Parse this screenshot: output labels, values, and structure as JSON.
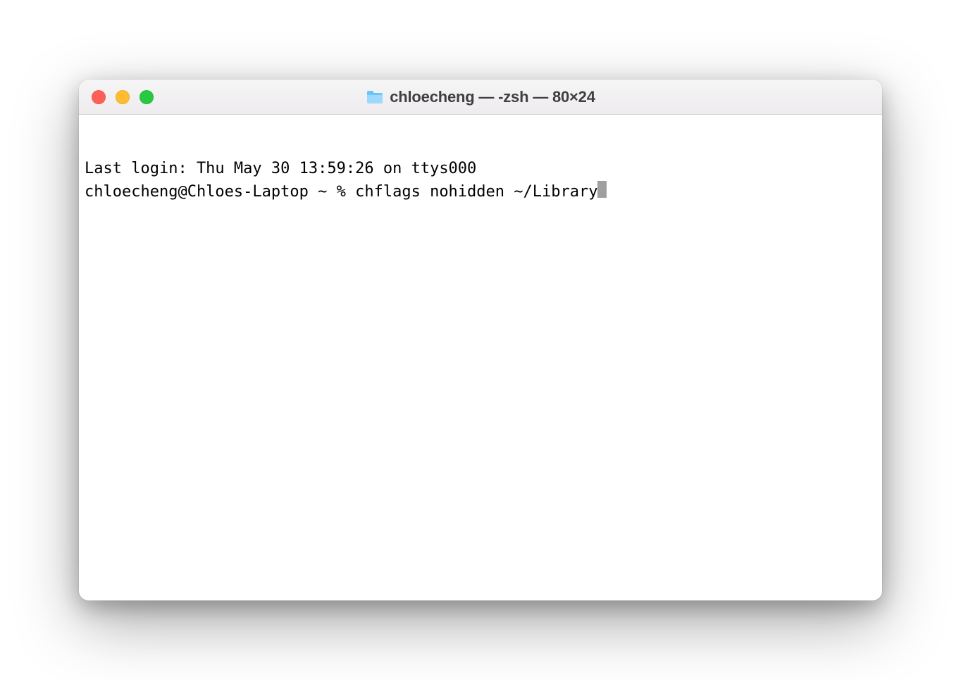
{
  "window": {
    "title": "chloecheng — -zsh — 80×24"
  },
  "terminal": {
    "last_login": "Last login: Thu May 30 13:59:26 on ttys000",
    "prompt": "chloecheng@Chloes-Laptop ~ % ",
    "command": "chflags nohidden ~/Library"
  }
}
